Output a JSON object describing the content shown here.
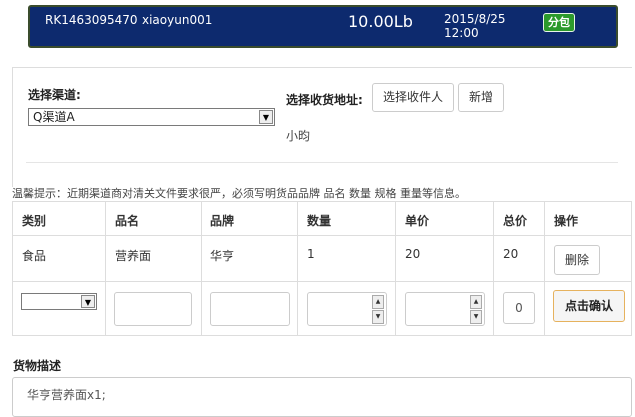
{
  "header": {
    "order_no": "RK1463095470",
    "username": "xiaoyun001",
    "weight": "10.00Lb",
    "date": "2015/8/25",
    "time": "12:00",
    "badge": "分包",
    "bg_color": "#0d2a6e",
    "badge_color": "#2c9a2c"
  },
  "form": {
    "channel_label": "选择渠道:",
    "channel_value": "Q渠道A",
    "address_label": "选择收货地址:",
    "select_recipient_btn": "选择收件人",
    "new_btn": "新增",
    "recipient_name": "小昀"
  },
  "tip": "温馨提示：近期渠道商对清关文件要求很严，必须写明货品品牌 品名 数量 规格 重量等信息。",
  "table": {
    "headers": [
      "类别",
      "品名",
      "品牌",
      "数量",
      "单价",
      "总价",
      "操作"
    ],
    "rows": [
      {
        "category": "食品",
        "name": "营养面",
        "brand": "华亨",
        "qty": "1",
        "unit_price": "20",
        "total": "20",
        "action": "删除"
      }
    ],
    "new_row": {
      "total_value": "0",
      "confirm_btn": "点击确认"
    }
  },
  "description": {
    "label": "货物描述",
    "value": "华亨营养面x1;"
  }
}
